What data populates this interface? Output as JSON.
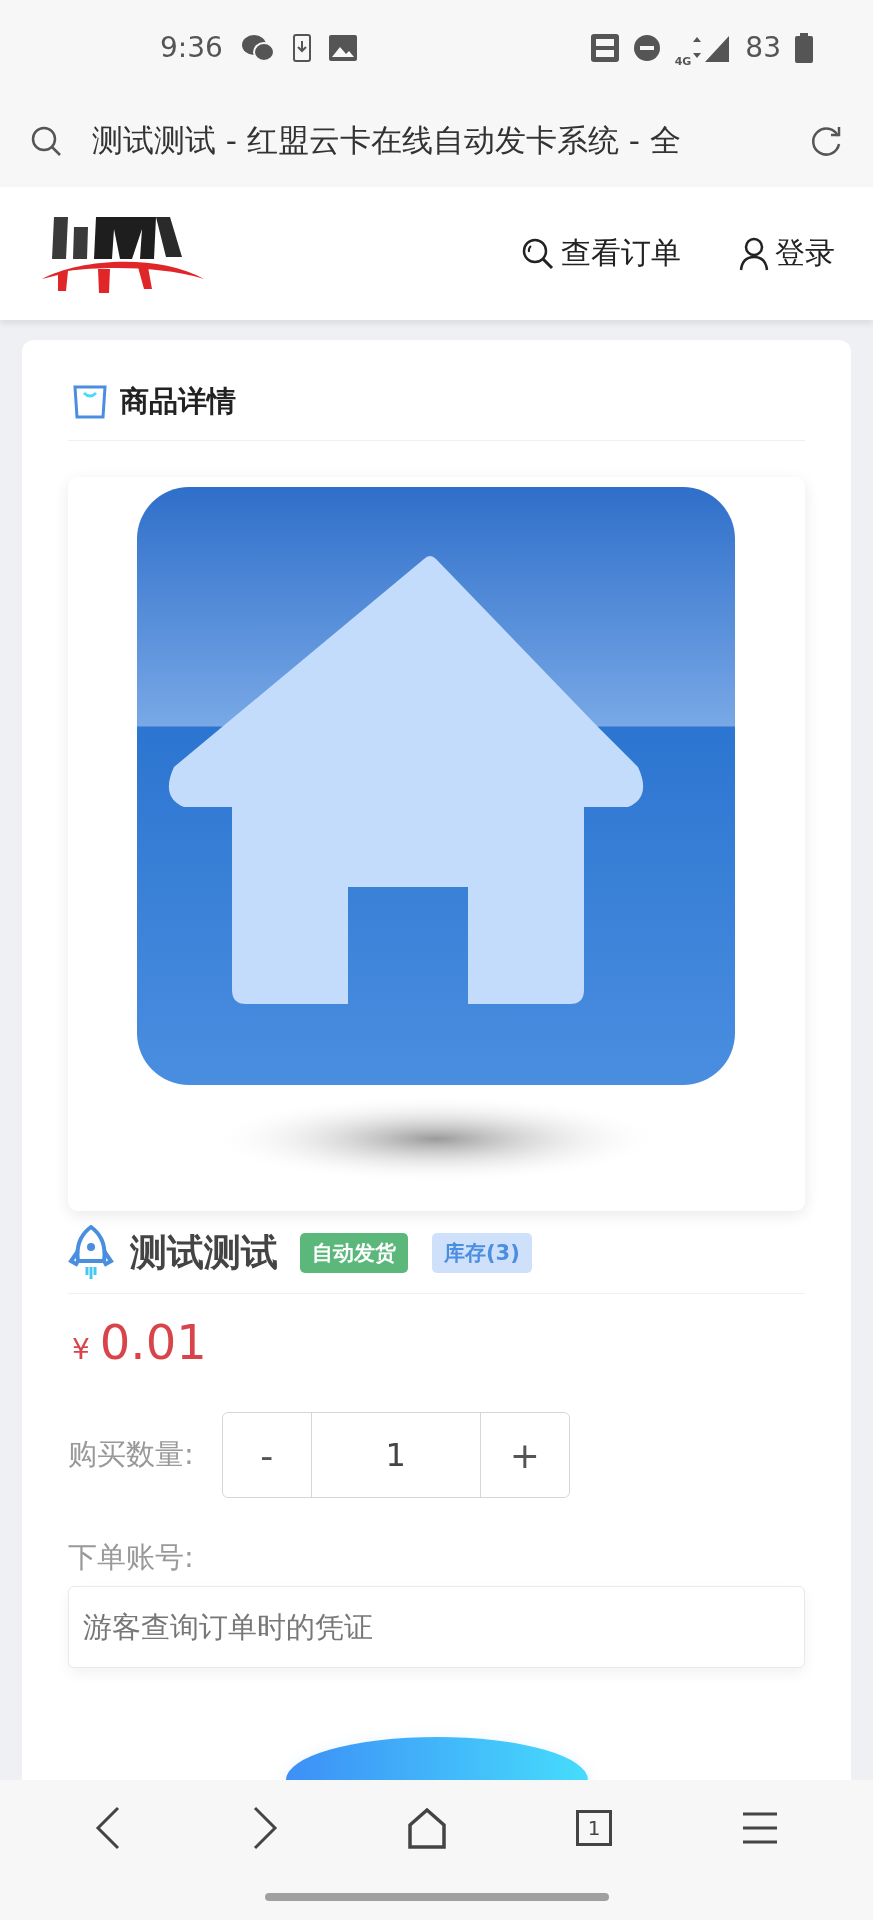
{
  "status_bar": {
    "time": "9:36",
    "network": "4G",
    "battery": "83"
  },
  "address_bar": {
    "title": "测试测试 - 红盟云卡在线自动发卡系统 - 全"
  },
  "header": {
    "nav": [
      {
        "kind": "orders",
        "label": "查看订单"
      },
      {
        "kind": "login",
        "label": "登录"
      }
    ]
  },
  "card": {
    "title": "商品详情",
    "product": {
      "name": "测试测试",
      "badges": [
        {
          "kind": "delivery",
          "text": "自动发货"
        },
        {
          "kind": "stock",
          "text": "库存(3)"
        }
      ],
      "price": {
        "currency": "¥",
        "amount": "0.01"
      }
    },
    "quantity": {
      "label": "购买数量:",
      "minus": "-",
      "value": "1",
      "plus": "+"
    },
    "account": {
      "label": "下单账号:",
      "placeholder": "游客查询订单时的凭证"
    },
    "order_button": {
      "kind": "partial"
    }
  },
  "toolbar": {
    "tab_count": "1"
  }
}
